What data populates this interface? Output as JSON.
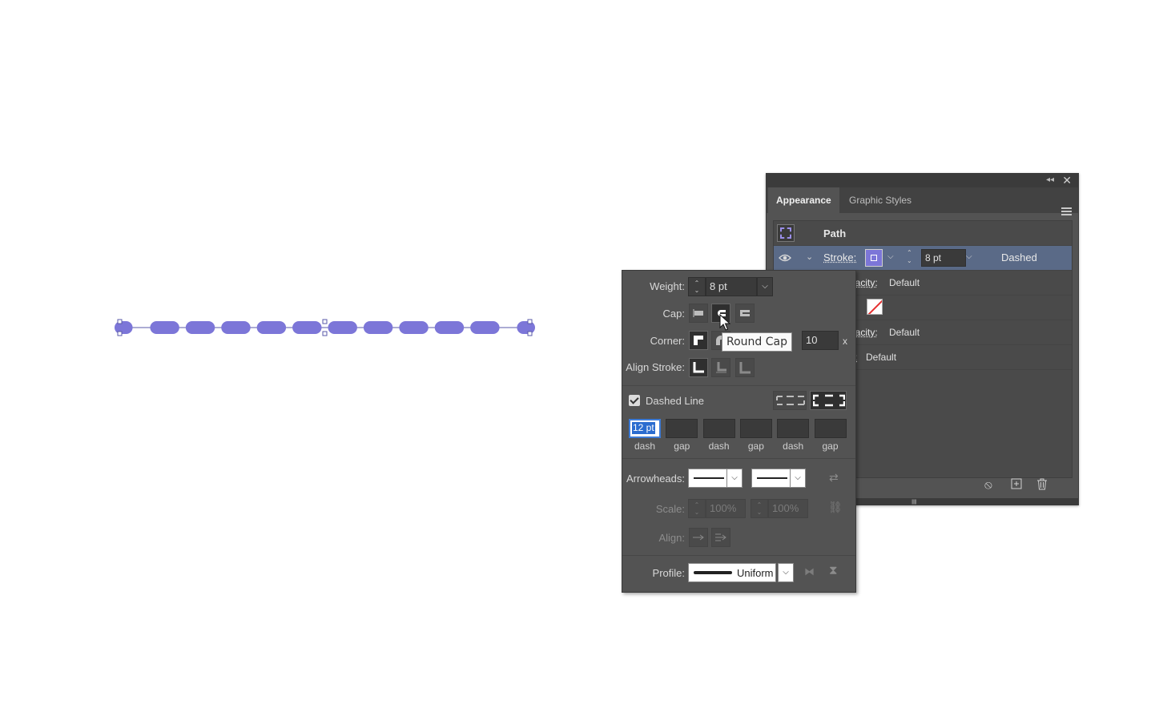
{
  "canvas": {
    "path_stroke_color": "#7c76d8",
    "path_stroke_weight_pt": 8,
    "visible_dash_segments": 12
  },
  "appearance_panel": {
    "tabs": [
      {
        "label": "Appearance",
        "active": true
      },
      {
        "label": "Graphic Styles",
        "active": false
      }
    ],
    "path_label": "Path",
    "stroke_row": {
      "label": "Stroke:",
      "weight": "8 pt",
      "style_label": "Dashed"
    },
    "opacity_row_1": {
      "label_partial": "pacity:",
      "value": "Default"
    },
    "opacity_row_2": {
      "label_partial": "pacity:",
      "value": "Default"
    },
    "last_row": {
      "label_partial": "y:",
      "value": "Default"
    },
    "icons": [
      "collapse-icon",
      "close-icon",
      "panel-menu-icon",
      "eye-icon",
      "clear-appearance-icon",
      "add-new-icon",
      "trash-icon"
    ]
  },
  "stroke_flyout": {
    "weight_label": "Weight:",
    "weight_value": "8 pt",
    "cap_label": "Cap:",
    "corner_label": "Corner:",
    "limit_label_partial": "t:",
    "limit_value": "10",
    "limit_unit": "x",
    "align_stroke_label": "Align Stroke:",
    "dashed_line_label": "Dashed Line",
    "dashed_line_checked": true,
    "dash_fields": [
      {
        "value": "12 pt",
        "caption": "dash"
      },
      {
        "value": "",
        "caption": "gap"
      },
      {
        "value": "",
        "caption": "dash"
      },
      {
        "value": "",
        "caption": "gap"
      },
      {
        "value": "",
        "caption": "dash"
      },
      {
        "value": "",
        "caption": "gap"
      }
    ],
    "arrowheads_label": "Arrowheads:",
    "scale_label": "Scale:",
    "scale_start": "100%",
    "scale_end": "100%",
    "align_label": "Align:",
    "profile_label": "Profile:",
    "profile_value": "Uniform"
  },
  "tooltip": {
    "text": "Round Cap"
  }
}
